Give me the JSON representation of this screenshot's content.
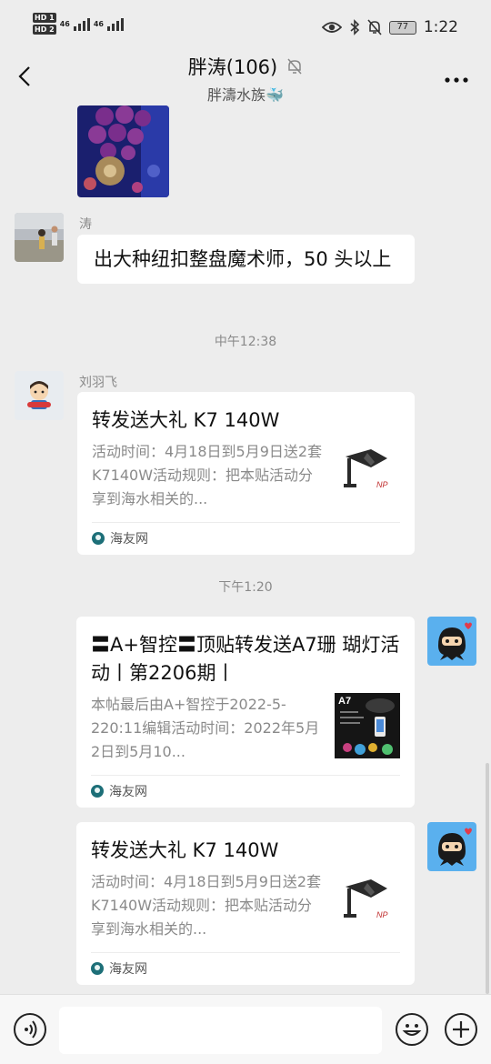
{
  "status_bar": {
    "hd1": "HD 1",
    "hd2": "HD 2",
    "net1": "46",
    "net2": "46",
    "battery": "77",
    "time": "1:22"
  },
  "header": {
    "title": "胖涛(106)",
    "subtitle": "胖濤水族🐳"
  },
  "messages": [
    {
      "sender": "涛",
      "text": "出大种纽扣整盘魔术师，50 头以上"
    },
    {
      "time": "中午12:38"
    },
    {
      "sender": "刘羽飞",
      "card": {
        "title": "转发送大礼 K7 140W",
        "desc": "活动时间：4月18日到5月9日送2套K7140W活动规则：把本贴活动分享到海水相关的...",
        "source": "海友网"
      }
    },
    {
      "time": "下午1:20"
    },
    {
      "card": {
        "title": "〓A+智控〓顶贴转发送A7珊 瑚灯活动丨第2206期丨",
        "desc": "本帖最后由A+智控于2022-5-220:11编辑活动时间：2022年5月2日到5月10...",
        "source": "海友网"
      }
    },
    {
      "card": {
        "title": "转发送大礼 K7 140W",
        "desc": "活动时间：4月18日到5月9日送2套K7140W活动规则：把本贴活动分享到海水相关的...",
        "source": "海友网"
      }
    }
  ],
  "icons": {
    "back": "chevron-left-icon",
    "mute": "bell-off-icon",
    "more": "more-dots-icon",
    "voice": "voice-icon",
    "emoji": "smiley-icon",
    "plus": "plus-icon"
  },
  "colors": {
    "background": "#ededed",
    "bubble": "#ffffff",
    "meta_text": "#8a8a8a",
    "source_icon": "#1d6f78"
  }
}
